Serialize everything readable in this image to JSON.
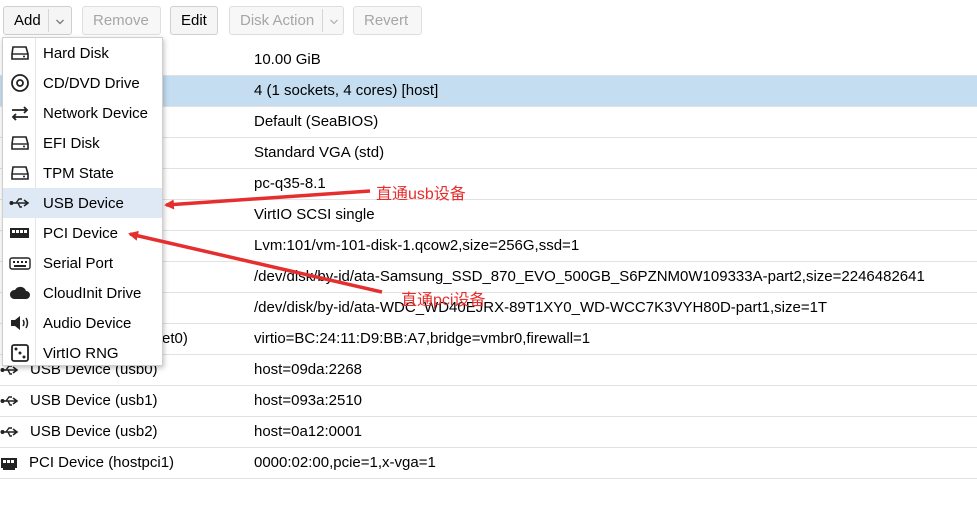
{
  "toolbar": {
    "add": "Add",
    "remove": "Remove",
    "edit": "Edit",
    "disk_action": "Disk Action",
    "revert": "Revert"
  },
  "rows": [
    {
      "key": "",
      "value": "10.00 GiB"
    },
    {
      "key": "",
      "value": "4 (1 sockets, 4 cores) [host]"
    },
    {
      "key": "",
      "value": "Default (SeaBIOS)"
    },
    {
      "key": "",
      "value": "Standard VGA (std)"
    },
    {
      "key": "",
      "value": "pc-q35-8.1"
    },
    {
      "key": "",
      "value": "VirtIO SCSI single"
    },
    {
      "key": "",
      "value": "Lvm:101/vm-101-disk-1.qcow2,size=256G,ssd=1"
    },
    {
      "key": "",
      "value": "/dev/disk/by-id/ata-Samsung_SSD_870_EVO_500GB_S6PZNM0W109333A-part2,size=2246482641"
    },
    {
      "key": "",
      "value": "/dev/disk/by-id/ata-WDC_WD40EJRX-89T1XY0_WD-WCC7K3VYH80D-part1,size=1T"
    },
    {
      "key": "et0)",
      "value": "virtio=BC:24:11:D9:BB:A7,bridge=vmbr0,firewall=1"
    },
    {
      "key": "USB Device (usb0)",
      "value": "host=09da:2268"
    },
    {
      "key": "USB Device (usb1)",
      "value": "host=093a:2510"
    },
    {
      "key": "USB Device (usb2)",
      "value": "host=0a12:0001"
    },
    {
      "key": "PCI Device (hostpci1)",
      "value": "0000:02:00,pcie=1,x-vga=1"
    }
  ],
  "menu": [
    {
      "label": "Hard Disk",
      "icon": "hdd-icon"
    },
    {
      "label": "CD/DVD Drive",
      "icon": "disc-icon"
    },
    {
      "label": "Network Device",
      "icon": "exchange-icon"
    },
    {
      "label": "EFI Disk",
      "icon": "hdd-icon"
    },
    {
      "label": "TPM State",
      "icon": "hdd-icon"
    },
    {
      "label": "USB Device",
      "icon": "usb-icon"
    },
    {
      "label": "PCI Device",
      "icon": "pci-card-icon"
    },
    {
      "label": "Serial Port",
      "icon": "keyboard-icon"
    },
    {
      "label": "CloudInit Drive",
      "icon": "cloud-icon"
    },
    {
      "label": "Audio Device",
      "icon": "volume-icon"
    },
    {
      "label": "VirtIO RNG",
      "icon": "dice-icon"
    }
  ],
  "annotations": {
    "usb": "直通usb设备",
    "pci": "直通pci设备"
  },
  "colors": {
    "selected_row": "#c5ddf0",
    "annotation": "#e52e2e"
  }
}
